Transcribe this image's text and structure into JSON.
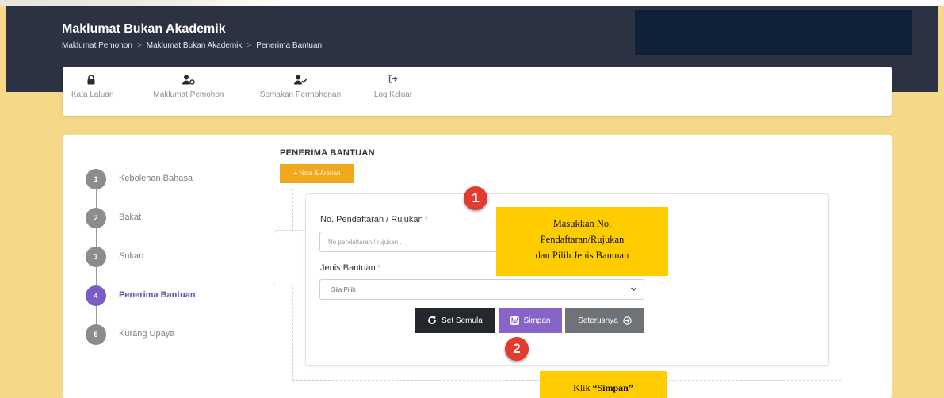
{
  "header": {
    "title": "Maklumat Bukan Akademik",
    "breadcrumb": [
      "Maklumat Pemohon",
      "Maklumat Bukan Akademik",
      "Penerima Bantuan"
    ],
    "breadcrumb_separator": ">"
  },
  "nav": {
    "items": [
      {
        "label": "Kata Laluan",
        "icon": "lock-icon"
      },
      {
        "label": "Maklumat Pemohon",
        "icon": "user-info-icon"
      },
      {
        "label": "Semakan Permohonan",
        "icon": "user-check-icon"
      },
      {
        "label": "Log Keluar",
        "icon": "sign-out-icon"
      }
    ]
  },
  "steps": [
    {
      "number": "1",
      "label": "Kebolehan Bahasa",
      "active": false
    },
    {
      "number": "2",
      "label": "Bakat",
      "active": false
    },
    {
      "number": "3",
      "label": "Sukan",
      "active": false
    },
    {
      "number": "4",
      "label": "Penerima Bantuan",
      "active": true
    },
    {
      "number": "5",
      "label": "Kurang Upaya",
      "active": false
    }
  ],
  "form": {
    "section_title": "PENERIMA BANTUAN",
    "nota_button": "+ Nota & Arahan",
    "registration_label": "No. Pendaftaran / Rujukan",
    "required_mark": "*",
    "registration_placeholder": "No pendaftaran / rujukan..",
    "registration_value": "",
    "aid_type_label": "Jenis Bantuan",
    "aid_type_selected": "Sila Pilih",
    "reset_button": "Set Semula",
    "save_button": "Simpan",
    "next_button": "Seterusnya"
  },
  "annotations": {
    "badge1": "1",
    "badge2": "2",
    "tip1_lines": [
      "Masukkan No.",
      "Pendaftaran/Rujukan",
      "dan Pilih Jenis Bantuan"
    ],
    "tip2_prefix": "Klik ",
    "tip2_bold": "“Simpan”"
  },
  "colors": {
    "header_bg": "#2c3242",
    "page_bg": "#f5d988",
    "accent_purple": "#8664c8",
    "nota_orange": "#f2a81d",
    "callout_yellow": "#ffcc00",
    "badge_red": "#e33b2e"
  }
}
